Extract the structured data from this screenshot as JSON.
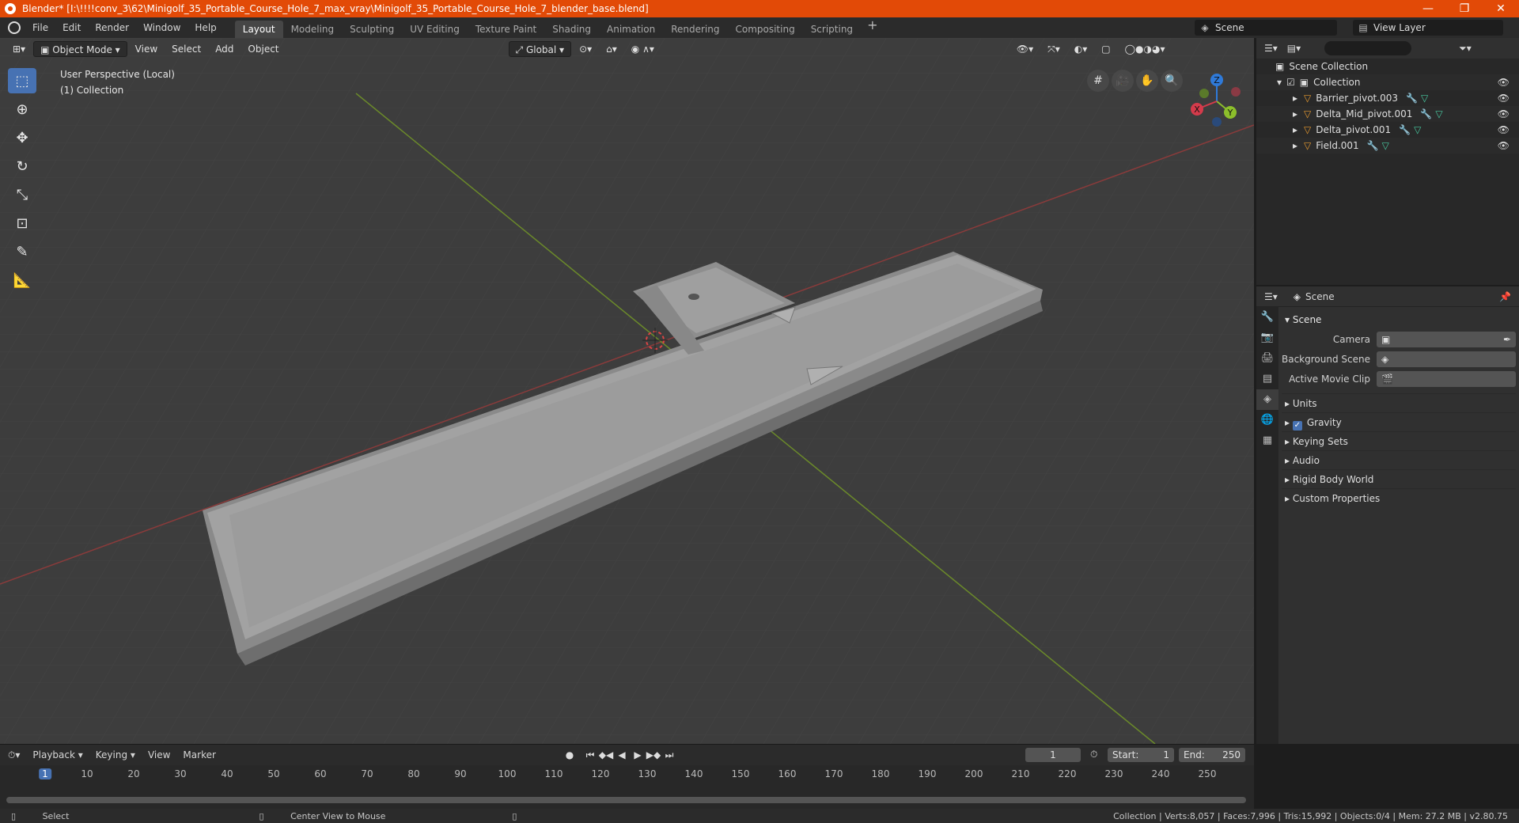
{
  "window": {
    "title": "Blender* [I:\\!!!!conv_3\\62\\Minigolf_35_Portable_Course_Hole_7_max_vray\\Minigolf_35_Portable_Course_Hole_7_blender_base.blend]",
    "minimize": "—",
    "maximize": "❐",
    "close": "✕"
  },
  "menu": [
    "File",
    "Edit",
    "Render",
    "Window",
    "Help"
  ],
  "workspaces": [
    "Layout",
    "Modeling",
    "Sculpting",
    "UV Editing",
    "Texture Paint",
    "Shading",
    "Animation",
    "Rendering",
    "Compositing",
    "Scripting"
  ],
  "workspace_add": "+",
  "scene_name": "Scene",
  "view_layer": "View Layer",
  "viewport": {
    "mode": "Object Mode",
    "menus": [
      "View",
      "Select",
      "Add",
      "Object"
    ],
    "orientation": "Global",
    "info_line1": "User Perspective (Local)",
    "info_line2": "(1) Collection",
    "gizmo": {
      "x": "X",
      "y": "Y",
      "z": "Z"
    }
  },
  "outliner": {
    "root": "Scene Collection",
    "collection": "Collection",
    "objects": [
      "Barrier_pivot.003",
      "Delta_Mid_pivot.001",
      "Delta_pivot.001",
      "Field.001"
    ]
  },
  "properties": {
    "header": "Scene",
    "panel": "Scene",
    "camera_label": "Camera",
    "background_scene_label": "Background Scene",
    "active_movie_clip_label": "Active Movie Clip",
    "subpanels": [
      "Units",
      "Gravity",
      "Keying Sets",
      "Audio",
      "Rigid Body World",
      "Custom Properties"
    ]
  },
  "timeline": {
    "menus": [
      "Playback",
      "Keying",
      "View",
      "Marker"
    ],
    "current_frame": "1",
    "start_label": "Start:",
    "start": "1",
    "end_label": "End:",
    "end": "250",
    "ticks": [
      "1",
      "10",
      "20",
      "30",
      "40",
      "50",
      "60",
      "70",
      "80",
      "90",
      "100",
      "110",
      "120",
      "130",
      "140",
      "150",
      "160",
      "170",
      "180",
      "190",
      "200",
      "210",
      "220",
      "230",
      "240",
      "250"
    ]
  },
  "statusbar": {
    "select": "Select",
    "center_view": "Center View to Mouse",
    "stats": "Collection | Verts:8,057 | Faces:7,996 | Tris:15,992 | Objects:0/4 | Mem: 27.2 MB | v2.80.75"
  },
  "colors": {
    "accent": "#4772b3",
    "titlebar": "#e24a07",
    "object_icon": "#e5992f",
    "mesh_icon": "#48c8a0"
  }
}
